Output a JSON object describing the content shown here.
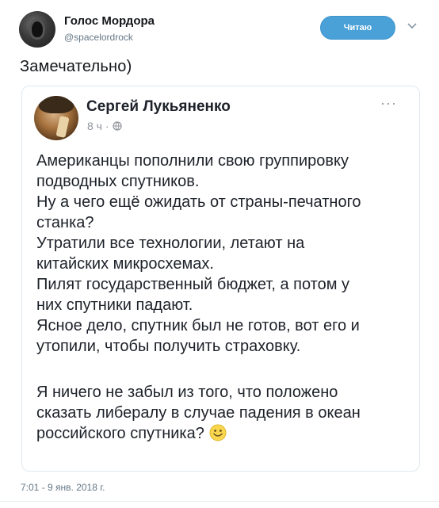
{
  "tweet": {
    "author_name": "Голос Мордора",
    "author_handle": "@spacelordrock",
    "follow_label": "Читаю",
    "text": "Замечательно)",
    "timestamp": "7:01 - 9 янв. 2018 г."
  },
  "quoted_post": {
    "author": "Сергей Лукьяненко",
    "time": "8 ч ·",
    "more_label": "···",
    "lines": [
      "Американцы пополнили свою группировку",
      "подводных спутников.",
      "Ну а чего ещё ожидать от страны-печатного",
      "станка?",
      "Утратили все технологии, летают на",
      "китайских микросхемах.",
      "Пилят государственный бюджет, а потом у",
      "них спутники падают.",
      "Ясное дело, спутник был не готов, вот его и",
      "утопили, чтобы получить страховку."
    ],
    "lines2": [
      "Я ничего не забыл из того, что положено",
      "сказать либералу в случае падения в океан",
      "российского спутника?"
    ],
    "emoji": "smiley-emoji"
  },
  "colors": {
    "follow_button": "#4aa1d7",
    "muted": "#657786",
    "card_border": "#e1e8ed"
  }
}
